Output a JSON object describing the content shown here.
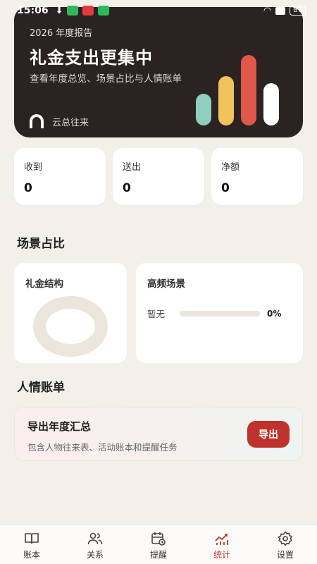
{
  "status_bar": {
    "time": "15:06",
    "battery": "87"
  },
  "hero": {
    "tag": "2026 年度报告",
    "headline": "礼金支出更集中",
    "description": "查看年度总览、场景占比与人情账单",
    "cloud_label": "云总往来",
    "bar_colors": [
      "#8fcfc0",
      "#f0c35c",
      "#e0584a",
      "#ffffff"
    ],
    "bar_levels": [
      0.45,
      0.7,
      1.0,
      0.6
    ]
  },
  "stats": [
    {
      "label": "收到",
      "value": "0"
    },
    {
      "label": "送出",
      "value": "0"
    },
    {
      "label": "净额",
      "value": "0"
    }
  ],
  "scene_section": {
    "title": "场景占比",
    "structure_title": "礼金结构",
    "freq_title": "高频场景",
    "freq_items": [
      {
        "name": "暂无",
        "percent": "0%",
        "level": 0
      }
    ]
  },
  "ledger_section": {
    "title": "人情账单",
    "export_title": "导出年度汇总",
    "export_subtitle": "包含人物往来表、活动账本和提醒任务",
    "export_button": "导出"
  },
  "nav": {
    "items": [
      {
        "label": "账本",
        "icon": "ledger-icon",
        "active": false
      },
      {
        "label": "关系",
        "icon": "people-icon",
        "active": false
      },
      {
        "label": "提醒",
        "icon": "calendar-clock-icon",
        "active": false
      },
      {
        "label": "统计",
        "icon": "chart-icon",
        "active": true
      },
      {
        "label": "设置",
        "icon": "gear-icon",
        "active": false
      }
    ]
  },
  "colors": {
    "accent": "#c0332c",
    "hero_bg": "#2a2321",
    "background": "#f3f0ea"
  }
}
